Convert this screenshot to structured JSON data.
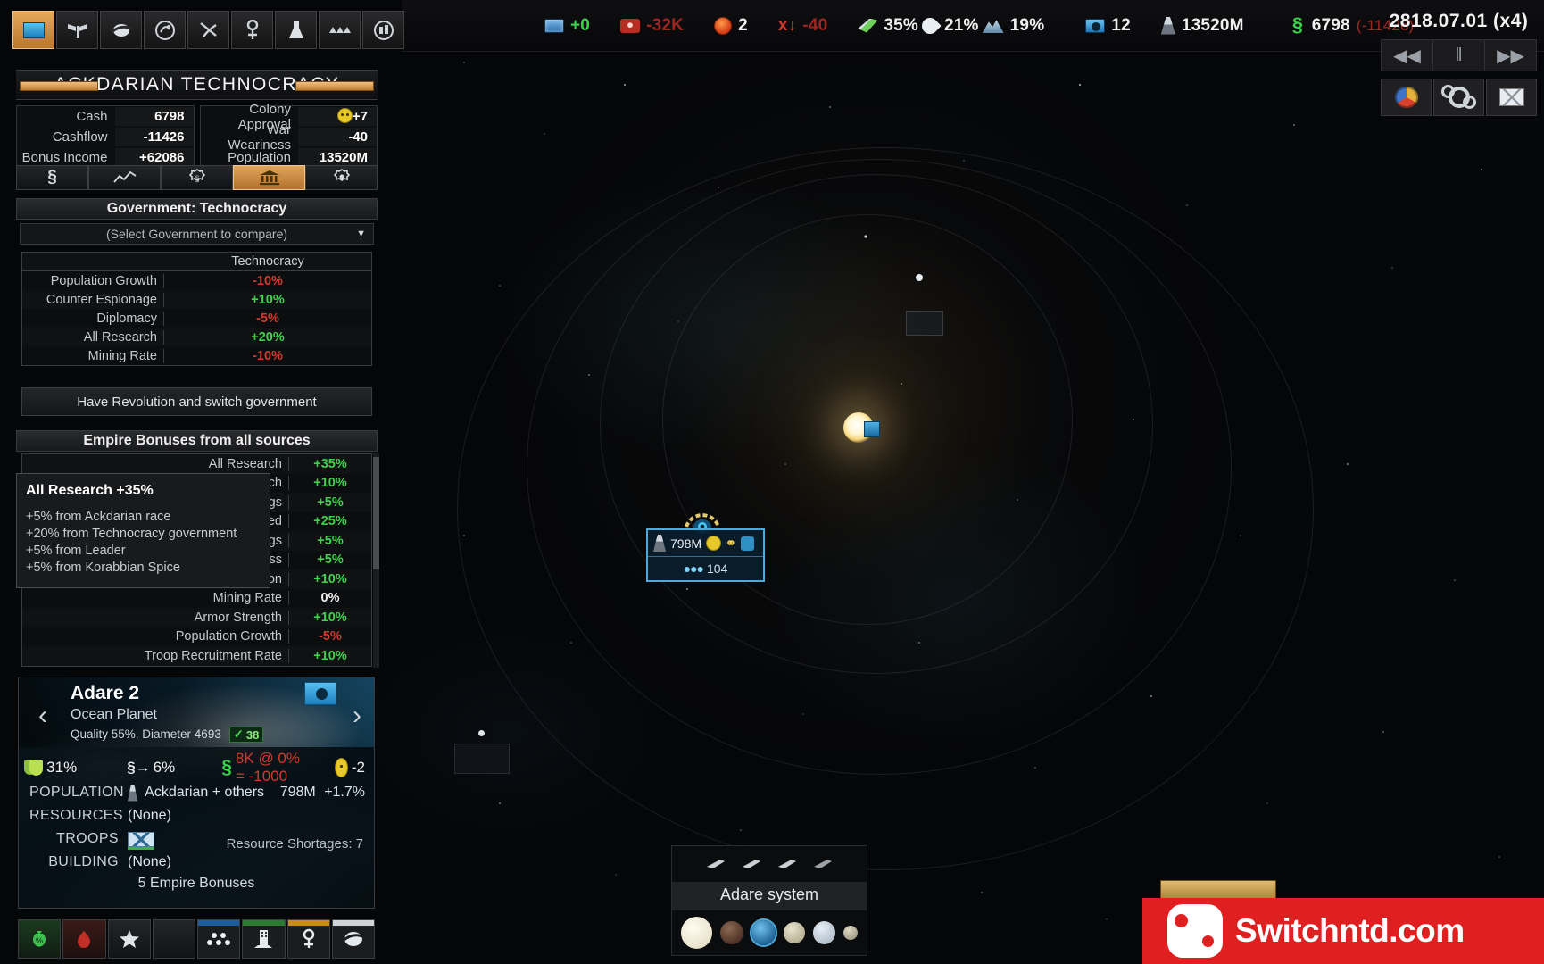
{
  "topbar": {
    "stats": [
      {
        "icon": "research-icon",
        "value": "+0",
        "color": "green"
      },
      {
        "icon": "maintenance-icon",
        "value": "-32K",
        "color": "red"
      },
      {
        "icon": "angry-face-icon",
        "value": "2",
        "color": "white"
      },
      {
        "icon": "war-weariness-icon",
        "value": "-40",
        "color": "red",
        "prefix": "x"
      },
      {
        "icon": "leaf-icon",
        "value": "35%",
        "color": "white"
      },
      {
        "icon": "water-drop-icon",
        "value": "21%",
        "color": "white"
      },
      {
        "icon": "mountain-icon",
        "value": "19%",
        "color": "white"
      },
      {
        "icon": "colony-icon",
        "value": "12",
        "color": "white"
      },
      {
        "icon": "population-icon",
        "value": "13520M",
        "color": "white"
      },
      {
        "icon": "cash-icon",
        "value": "6798",
        "color": "white",
        "sub": "(-11426)"
      }
    ]
  },
  "time": {
    "date": "2818.07.01 (x4)",
    "rewind_label": "◀◀",
    "pause_label": "‖",
    "forward_label": "▶▶",
    "buttons": [
      "diplomacy-icon",
      "research-tree-icon",
      "messages-icon"
    ]
  },
  "toolbar_top": {
    "buttons": [
      {
        "name": "empire-overview-icon",
        "selected": true
      },
      {
        "name": "diplomacy-flags-icon",
        "selected": false
      },
      {
        "name": "planets-icon",
        "selected": false
      },
      {
        "name": "galaxy-map-icon",
        "selected": false
      },
      {
        "name": "mining-pick-icon",
        "selected": false
      },
      {
        "name": "research-icon",
        "selected": false
      },
      {
        "name": "construction-icon",
        "selected": false
      },
      {
        "name": "fleets-icon",
        "selected": false
      },
      {
        "name": "colonies-grid-icon",
        "selected": false
      }
    ]
  },
  "empire": {
    "title": "ACKDARIAN TECHNOCRACY",
    "stats_left": [
      {
        "label": "Cash",
        "value": "6798",
        "color": "white"
      },
      {
        "label": "Cashflow",
        "value": "-11426",
        "color": "red"
      },
      {
        "label": "Bonus Income",
        "value": "+62086",
        "color": "white"
      }
    ],
    "stats_right": [
      {
        "label": "Colony Approval",
        "value": "+7",
        "color": "white",
        "icon": "smile-face-icon"
      },
      {
        "label": "War Weariness",
        "value": "-40",
        "color": "white"
      },
      {
        "label": "Population",
        "value": "13520M",
        "color": "white"
      }
    ],
    "tabs": [
      {
        "name": "tab-economy",
        "icon": "cash-icon",
        "selected": false
      },
      {
        "name": "tab-graphs",
        "icon": "chart-line-icon",
        "selected": false
      },
      {
        "name": "tab-trade",
        "icon": "trade-gear-icon",
        "selected": false
      },
      {
        "name": "tab-government",
        "icon": "government-building-icon",
        "selected": true
      },
      {
        "name": "tab-policy",
        "icon": "policy-gear-icon",
        "selected": false
      }
    ]
  },
  "government": {
    "header": "Government: Technocracy",
    "compare_placeholder": "(Select Government to compare)",
    "caret": "▼",
    "column_header": "Technocracy",
    "rows": [
      {
        "label": "Population Growth",
        "value": "-10%",
        "color": "red"
      },
      {
        "label": "Counter Espionage",
        "value": "+10%",
        "color": "green"
      },
      {
        "label": "Diplomacy",
        "value": "-5%",
        "color": "red"
      },
      {
        "label": "All Research",
        "value": "+20%",
        "color": "green"
      },
      {
        "label": "Mining Rate",
        "value": "-10%",
        "color": "red"
      }
    ],
    "revolution_button": "Have Revolution and switch government"
  },
  "empire_bonuses": {
    "header": "Empire Bonuses from all sources",
    "rows": [
      {
        "label": "All Research",
        "value": "+35%",
        "color": "green"
      },
      {
        "label": "Energy Research",
        "value": "+10%",
        "color": "green"
      },
      {
        "label": "Troop Hit Point Savings",
        "value": "+5%",
        "color": "green"
      },
      {
        "label": "Ship Construction Speed",
        "value": "+25%",
        "color": "green"
      },
      {
        "label": "Ship Maintenance Savings",
        "value": "+5%",
        "color": "green"
      },
      {
        "label": "Population Happiness",
        "value": "+5%",
        "color": "green"
      },
      {
        "label": "Colony Corruption Reduction",
        "value": "+10%",
        "color": "green"
      },
      {
        "label": "Mining Rate",
        "value": "0%",
        "color": "white"
      },
      {
        "label": "Armor Strength",
        "value": "+10%",
        "color": "green"
      },
      {
        "label": "Population Growth",
        "value": "-5%",
        "color": "red"
      },
      {
        "label": "Troop Recruitment Rate",
        "value": "+10%",
        "color": "green"
      }
    ]
  },
  "tooltip": {
    "title": "All Research +35%",
    "lines": [
      "+5% from Ackdarian race",
      "+20% from Technocracy government",
      "+5% from Leader",
      "+5% from Korabbian Spice"
    ]
  },
  "planet_card": {
    "name": "Adare 2",
    "type": "Ocean Planet",
    "quality": "Quality 55%, Diameter 4693",
    "quality_badge": "38",
    "quality_check": "✓",
    "prev_arrow": "‹",
    "next_arrow": "›",
    "indicators": [
      {
        "icon": "happiness-mask-icon",
        "value": "31%",
        "color": "white"
      },
      {
        "icon": "energy-bolt-icon",
        "value": "6%",
        "color": "white"
      },
      {
        "icon": "cash-icon",
        "value": "8K @ 0% = -1000",
        "color": "red"
      },
      {
        "icon": "approval-face-icon",
        "value": "-2",
        "color": "white"
      }
    ],
    "rows": [
      {
        "key": "POPULATION",
        "value": "Ackdarian + others",
        "extra": "798M",
        "growth": "+1.7%",
        "icon": "population-icon"
      },
      {
        "key": "RESOURCES",
        "value": "(None)"
      },
      {
        "key": "TROOPS",
        "value": "",
        "icon": "troops-icon"
      },
      {
        "key": "BUILDING",
        "value": "(None)"
      }
    ],
    "shortages": "Resource Shortages: 7",
    "bonuses_line": "5 Empire Bonuses"
  },
  "bottom_toolbar": {
    "buttons": [
      {
        "name": "money-bag-icon",
        "style": "g"
      },
      {
        "name": "alert-icon",
        "style": "r"
      },
      {
        "name": "favorite-star-icon",
        "style": "n"
      },
      {
        "name": "empty-slot",
        "style": "n"
      },
      {
        "name": "population-dots-icon",
        "style": "blue-top"
      },
      {
        "name": "building-icon",
        "style": "green-top"
      },
      {
        "name": "research-icon",
        "style": "orange-top"
      },
      {
        "name": "planet-icon",
        "style": "white-top"
      }
    ]
  },
  "space": {
    "planet_tooltip": {
      "population": "798M",
      "troops": "104",
      "icons": [
        "population-icon",
        "unhappy-face-icon",
        "research-icon",
        "shield-icon"
      ]
    },
    "system_bar": {
      "name": "Adare system",
      "ships": 4,
      "planets": 6
    }
  },
  "watermark": {
    "text": "Switchntd.com",
    "color": "#e02020"
  }
}
